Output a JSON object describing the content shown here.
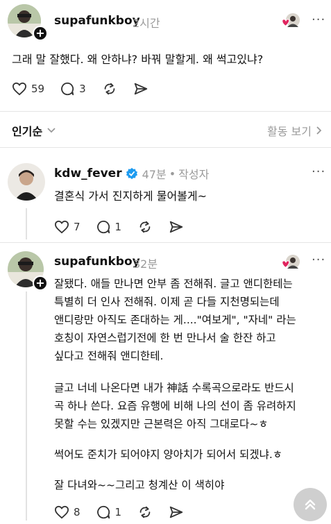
{
  "post": {
    "username": "supafunkboy",
    "time": "2시간",
    "text": "그래 말 잘했다. 왜 안하냐? 바꿔 말할게.  왜 썩고있냐?",
    "likes": "59",
    "replies": "3"
  },
  "sort": {
    "label": "인기순",
    "activity": "활동 보기"
  },
  "comments": [
    {
      "username": "kdw_fever",
      "time": "47분",
      "author_tag": "작성자",
      "text": "결혼식 가서 진지하게 물어볼게~",
      "likes": "7",
      "replies": "1"
    },
    {
      "username": "supafunkboy",
      "time": "32분",
      "paragraphs": [
        "잘됐다. 애들 만나면 안부 좀 전해줘. 글고 앤디한테는",
        "특별히 더 인사 전해줘. 이제 곧 다들 지천명되는데",
        "앤디랑만 아직도 존대하는 게....\"여보게\", \"자네\" 라는",
        "호칭이 자연스럽기전에 한 번 만나서 술 한잔 하고",
        "싶다고 전해줘 앤디한테.",
        "글고 너네 나온다면 내가 神話 수록곡으로라도 반드시",
        "곡 하나 쓴다. 요즘 유행에 비해 나의 선이 좀 유려하지",
        "못할 수는 있겠지만 근본력은 아직 그대로다~ㅎ",
        "썩어도 준치가 되어야지 양아치가 되어서 되겠냐.ㅎ",
        "잘 다녀와~~그리고 청계산 이 색히야"
      ],
      "likes": "8",
      "replies": "1"
    }
  ],
  "colors": {
    "verified": "#1d9bf0",
    "heart": "#e0245e",
    "muted": "#9a9a9a"
  }
}
